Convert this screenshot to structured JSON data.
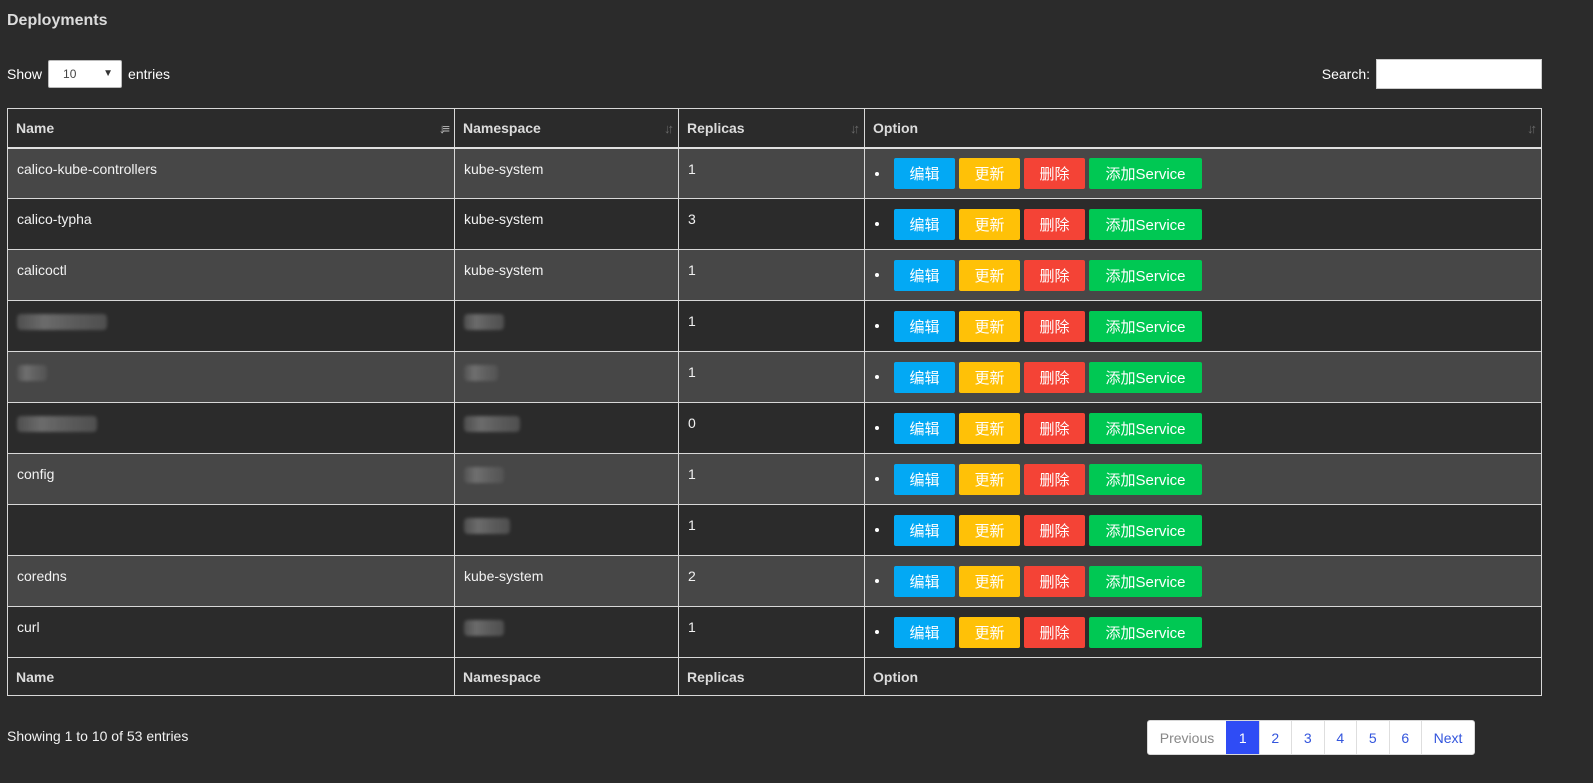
{
  "page": {
    "title": "Deployments"
  },
  "length": {
    "show_label": "Show",
    "value": "10",
    "entries_label": "entries"
  },
  "search": {
    "label": "Search:",
    "value": "",
    "placeholder": ""
  },
  "table": {
    "columns": [
      "Name",
      "Namespace",
      "Replicas",
      "Option"
    ],
    "rows": [
      {
        "name": "calico-kube-controllers",
        "namespace": "kube-system",
        "replicas": "1"
      },
      {
        "name": "calico-typha",
        "namespace": "kube-system",
        "replicas": "3"
      },
      {
        "name": "calicoctl",
        "namespace": "kube-system",
        "replicas": "1"
      },
      {
        "name": "",
        "namespace": "",
        "replicas": "1"
      },
      {
        "name": "",
        "namespace": "",
        "replicas": "1"
      },
      {
        "name": "",
        "namespace": "",
        "replicas": "0"
      },
      {
        "name": "config",
        "namespace": "",
        "replicas": "1"
      },
      {
        "name": "",
        "namespace": "",
        "replicas": "1"
      },
      {
        "name": "coredns",
        "namespace": "kube-system",
        "replicas": "2"
      },
      {
        "name": "curl",
        "namespace": "",
        "replicas": "1"
      }
    ],
    "actions": {
      "edit": "编辑",
      "update": "更新",
      "delete": "删除",
      "add_service": "添加Service"
    }
  },
  "info": "Showing 1 to 10 of 53 entries",
  "pagination": {
    "previous": "Previous",
    "pages": [
      "1",
      "2",
      "3",
      "4",
      "5",
      "6"
    ],
    "current": "1",
    "next": "Next"
  },
  "colors": {
    "edit": "#03a9f4",
    "update": "#ffc107",
    "delete": "#f44336",
    "add_service": "#00c853",
    "page_active": "#2f4cf5"
  },
  "icons": {
    "sort_active": "sort-asc-icon",
    "sort": "sort-both-icon"
  }
}
